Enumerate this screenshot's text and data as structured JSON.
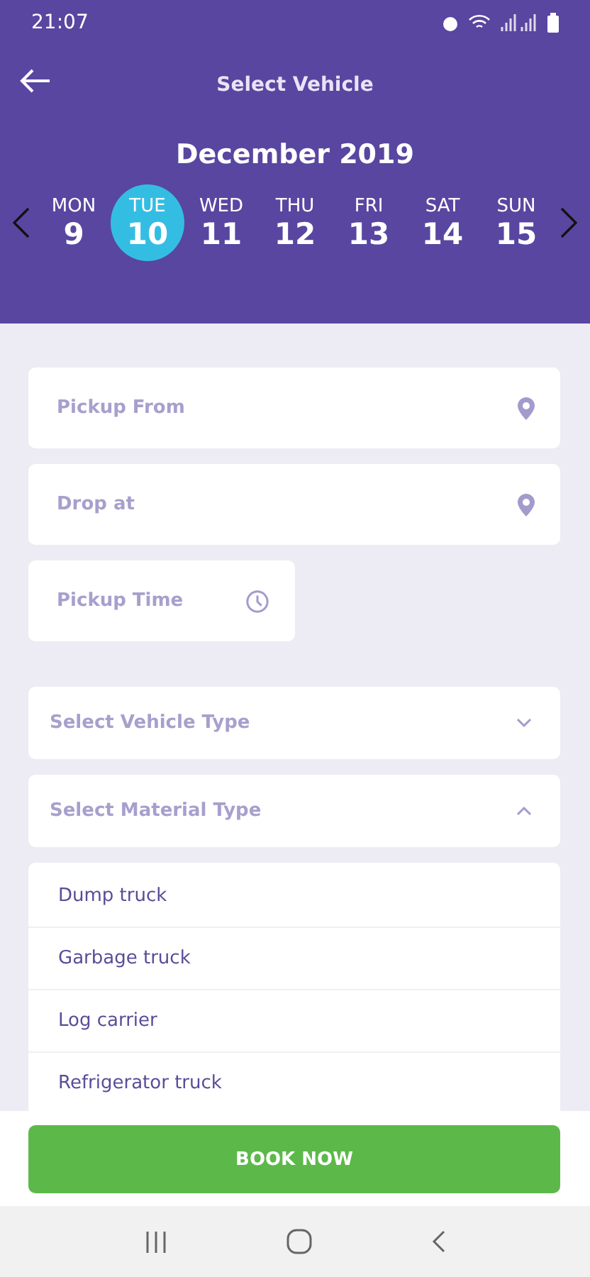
{
  "status_bar": {
    "time": "21:07"
  },
  "header": {
    "title": "Select Vehicle",
    "month": "December 2019"
  },
  "days": [
    {
      "name": "MON",
      "date": "9",
      "selected": false
    },
    {
      "name": "TUE",
      "date": "10",
      "selected": true
    },
    {
      "name": "WED",
      "date": "11",
      "selected": false
    },
    {
      "name": "THU",
      "date": "12",
      "selected": false
    },
    {
      "name": "FRI",
      "date": "13",
      "selected": false
    },
    {
      "name": "SAT",
      "date": "14",
      "selected": false
    },
    {
      "name": "SUN",
      "date": "15",
      "selected": false
    }
  ],
  "fields": [
    {
      "placeholder": "Pickup From",
      "kind": "location"
    },
    {
      "placeholder": "Drop at",
      "kind": "location"
    },
    {
      "placeholder": "Pickup Time",
      "kind": "time"
    }
  ],
  "dropdowns": [
    {
      "label": "Select Vehicle Type",
      "expanded": false
    },
    {
      "label": "Select Material Type",
      "expanded": true
    }
  ],
  "material_options": [
    "Dump truck",
    "Garbage truck",
    "Log carrier",
    "Refrigerator truck"
  ],
  "book_button": "BOOK NOW"
}
